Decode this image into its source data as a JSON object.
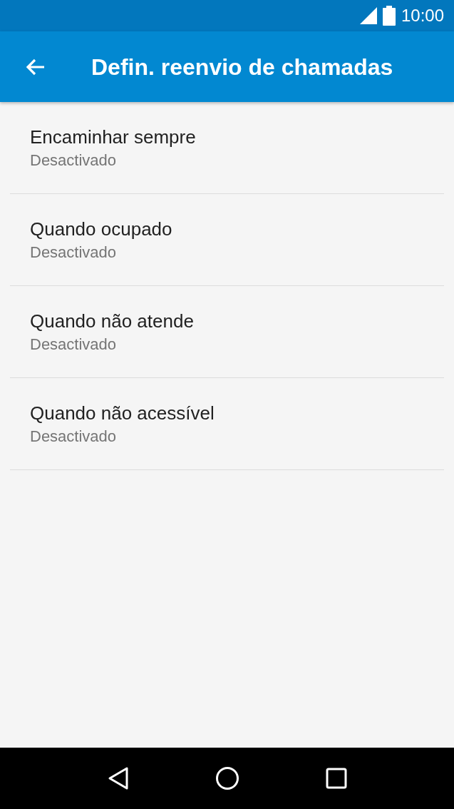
{
  "status_bar": {
    "time": "10:00"
  },
  "app_bar": {
    "title": "Defin. reenvio de chamadas"
  },
  "items": [
    {
      "title": "Encaminhar sempre",
      "subtitle": "Desactivado"
    },
    {
      "title": "Quando ocupado",
      "subtitle": "Desactivado"
    },
    {
      "title": "Quando não atende",
      "subtitle": "Desactivado"
    },
    {
      "title": "Quando não acessível",
      "subtitle": "Desactivado"
    }
  ]
}
